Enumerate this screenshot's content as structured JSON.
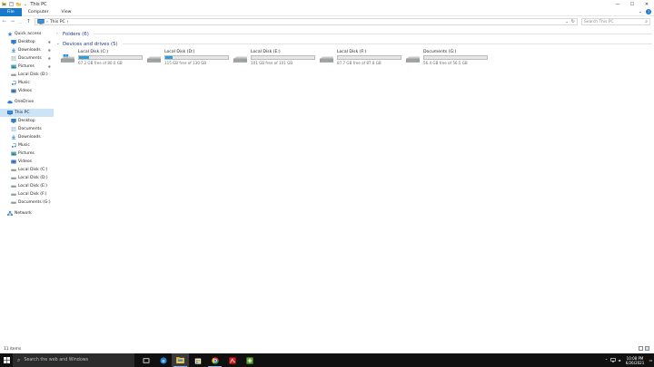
{
  "window": {
    "title": "This PC",
    "controls": {
      "minimize": "—",
      "maximize": "☐",
      "close": "✕"
    }
  },
  "ribbon": {
    "tabs": [
      "File",
      "Computer",
      "View"
    ],
    "expand_icon": "⌄",
    "help_label": "?"
  },
  "address": {
    "back": "←",
    "forward": "→",
    "recent": "⌄",
    "up": "↑",
    "path_separator": "›",
    "path": [
      "This PC"
    ],
    "dropdown": "⌄",
    "refresh": "↻",
    "search_placeholder": "Search This PC"
  },
  "nav": {
    "pin_symbol": "✱",
    "quick_access_label": "Quick access",
    "quick_access": [
      {
        "label": "Desktop",
        "icon": "desktop-icon",
        "pinned": true
      },
      {
        "label": "Downloads",
        "icon": "downloads-icon",
        "pinned": true
      },
      {
        "label": "Documents",
        "icon": "documents-icon",
        "pinned": true
      },
      {
        "label": "Pictures",
        "icon": "pictures-icon",
        "pinned": true
      },
      {
        "label": "Local Disk (D:)",
        "icon": "drive-icon",
        "pinned": false
      },
      {
        "label": "Music",
        "icon": "music-icon",
        "pinned": false
      },
      {
        "label": "Videos",
        "icon": "videos-icon",
        "pinned": false
      }
    ],
    "onedrive": "OneDrive",
    "this_pc": "This PC",
    "this_pc_items": [
      {
        "label": "Desktop",
        "icon": "desktop-icon"
      },
      {
        "label": "Documents",
        "icon": "documents-icon"
      },
      {
        "label": "Downloads",
        "icon": "downloads-icon"
      },
      {
        "label": "Music",
        "icon": "music-icon"
      },
      {
        "label": "Pictures",
        "icon": "pictures-icon"
      },
      {
        "label": "Videos",
        "icon": "videos-icon"
      },
      {
        "label": "Local Disk (C:)",
        "icon": "drive-icon"
      },
      {
        "label": "Local Disk (D:)",
        "icon": "drive-icon"
      },
      {
        "label": "Local Disk (E:)",
        "icon": "drive-icon"
      },
      {
        "label": "Local Disk (F:)",
        "icon": "drive-icon"
      },
      {
        "label": "Documents (G:)",
        "icon": "drive-icon"
      }
    ],
    "network": "Network"
  },
  "content": {
    "folders_group": "Folders (6)",
    "devices_group": "Devices and drives (5)",
    "collapsed_chevron": "›",
    "expanded_chevron": "⌄",
    "drives": [
      {
        "name": "Local Disk (C:)",
        "free": "67.2 GB free of 80.0 GB",
        "used_fraction": 0.16,
        "windows": true
      },
      {
        "name": "Local Disk (D:)",
        "free": "115 GB free of 130 GB",
        "used_fraction": 0.12,
        "windows": false
      },
      {
        "name": "Local Disk (E:)",
        "free": "101 GB free of 101 GB",
        "used_fraction": 0.0,
        "windows": false
      },
      {
        "name": "Local Disk (F:)",
        "free": "87.7 GB free of 87.8 GB",
        "used_fraction": 0.0,
        "windows": false
      },
      {
        "name": "Documents (G:)",
        "free": "56.4 GB free of 56.5 GB",
        "used_fraction": 0.0,
        "windows": false
      }
    ]
  },
  "status": {
    "items": "11 items"
  },
  "taskbar": {
    "search_placeholder": "Search the web and Windows",
    "apps": [
      "task-view-icon",
      "edge-icon",
      "file-explorer-icon",
      "store-icon",
      "chrome-icon",
      "acrobat-icon",
      "app-green-icon"
    ],
    "time": "10:08 PM",
    "date": "6/26/2021",
    "tray_up": "⌃",
    "tray_speaker": "◄",
    "tray_notifications": "▭"
  },
  "colors": {
    "accent": "#1979ca",
    "drive_bar": "#26a0da",
    "selection": "#cce4f7",
    "taskbar": "#101010"
  }
}
